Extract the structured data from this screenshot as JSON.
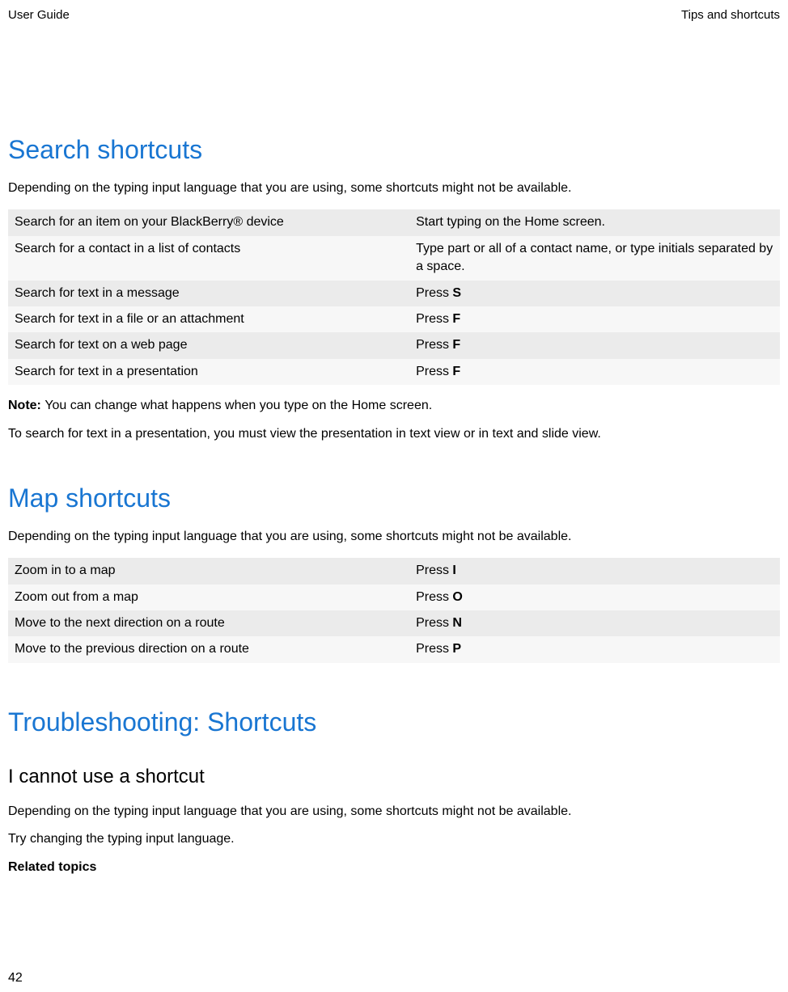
{
  "header": {
    "left": "User Guide",
    "right": "Tips and shortcuts"
  },
  "sections": {
    "search": {
      "title": "Search shortcuts",
      "intro": "Depending on the typing input language that you are using, some shortcuts might not be available.",
      "rows": [
        {
          "action": "Search for an item on your BlackBerry® device",
          "key_prefix": "Start typing on the Home screen.",
          "key_bold": ""
        },
        {
          "action": "Search for a contact in a list of contacts",
          "key_prefix": "Type part or all of a contact name, or type initials separated by a space.",
          "key_bold": ""
        },
        {
          "action": "Search for text in a message",
          "key_prefix": "Press ",
          "key_bold": "S"
        },
        {
          "action": "Search for text in a file or an attachment",
          "key_prefix": "Press ",
          "key_bold": "F"
        },
        {
          "action": "Search for text on a web page",
          "key_prefix": "Press ",
          "key_bold": "F"
        },
        {
          "action": "Search for text in a presentation",
          "key_prefix": "Press ",
          "key_bold": "F"
        }
      ],
      "note_label": "Note: ",
      "note_text": "You can change what happens when you type on the Home screen.",
      "para2": "To search for text in a presentation, you must view the presentation in text view or in text and slide view."
    },
    "map": {
      "title": "Map shortcuts",
      "intro": "Depending on the typing input language that you are using, some shortcuts might not be available.",
      "rows": [
        {
          "action": "Zoom in to a map",
          "key_prefix": "Press ",
          "key_bold": "I"
        },
        {
          "action": "Zoom out from a map",
          "key_prefix": "Press ",
          "key_bold": "O"
        },
        {
          "action": "Move to the next direction on a route",
          "key_prefix": "Press ",
          "key_bold": "N"
        },
        {
          "action": "Move to the previous direction on a route",
          "key_prefix": "Press ",
          "key_bold": "P"
        }
      ]
    },
    "troubleshoot": {
      "title": "Troubleshooting: Shortcuts",
      "sub1": {
        "title": "I cannot use a shortcut",
        "para1": "Depending on the typing input language that you are using, some shortcuts might not be available.",
        "para2": "Try changing the typing input language.",
        "related": "Related topics"
      }
    }
  },
  "page_number": "42"
}
